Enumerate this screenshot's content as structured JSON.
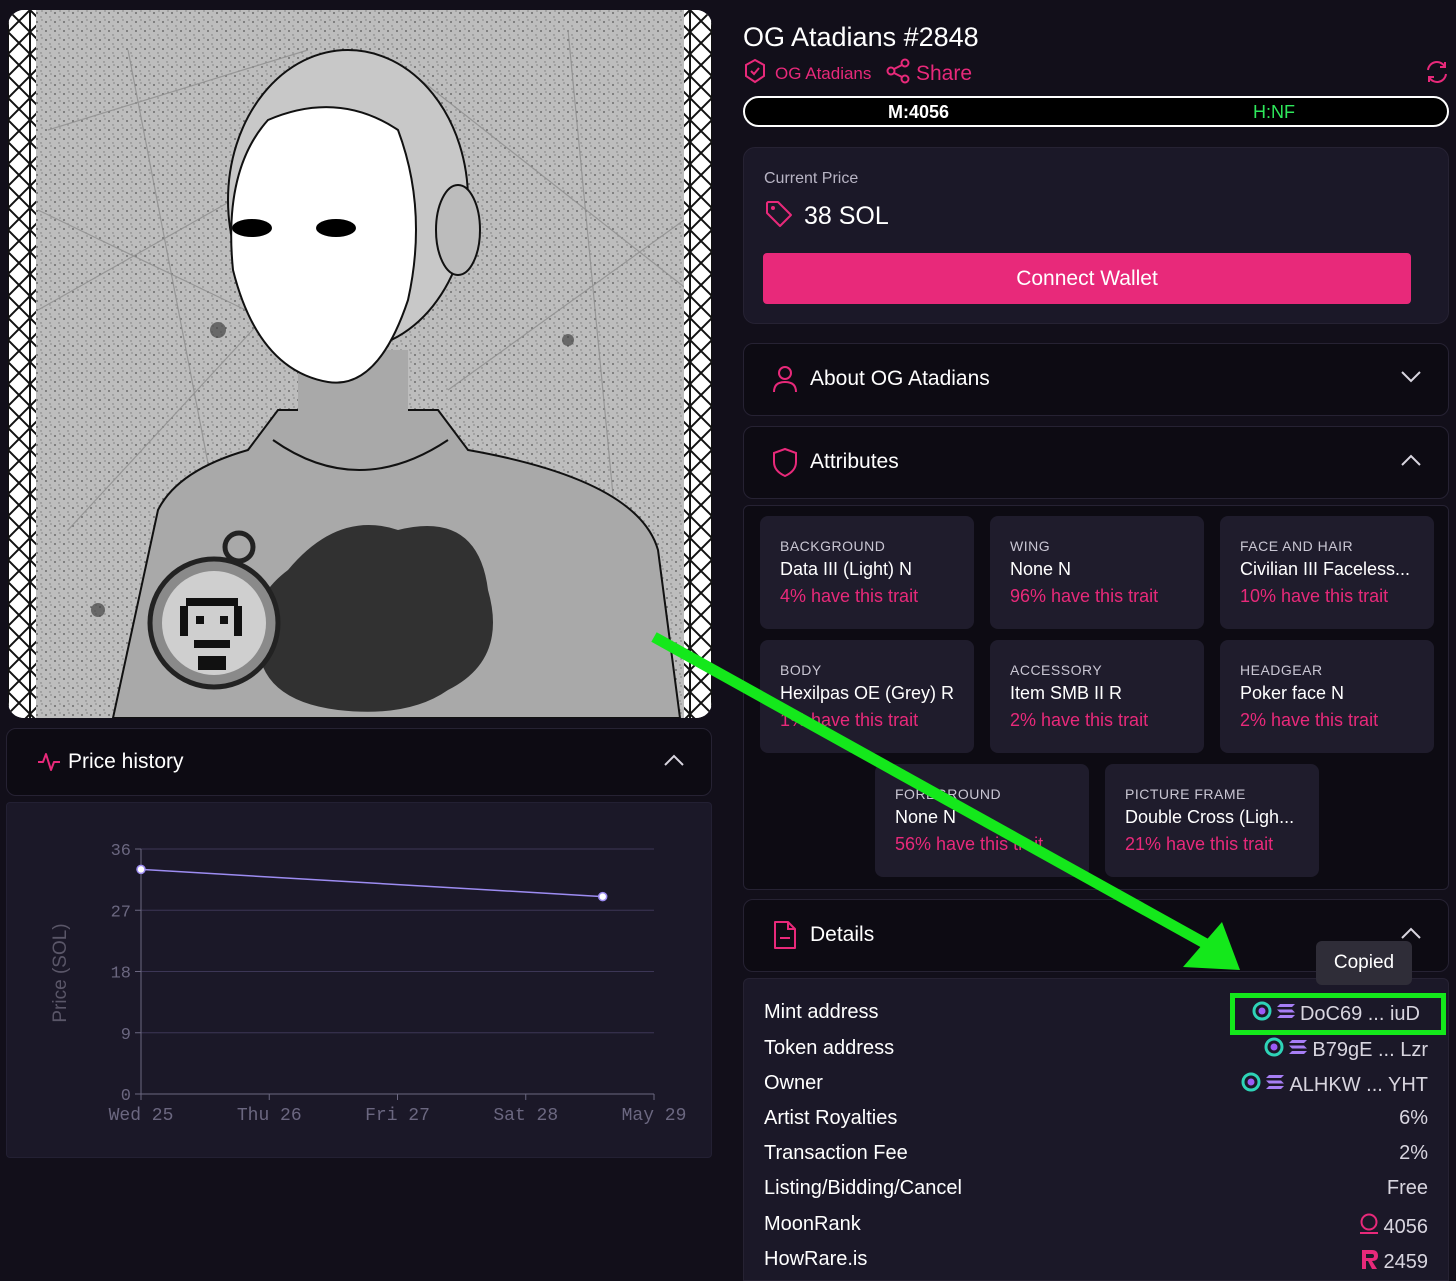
{
  "nft": {
    "title": "OG Atadians #2848",
    "collection": "OG Atadians",
    "share_label": "Share",
    "rank": {
      "m_label": "M:4056",
      "h_label": "H:NF"
    }
  },
  "price": {
    "label": "Current Price",
    "value": "38 SOL",
    "connect_label": "Connect Wallet"
  },
  "about": {
    "label": "About OG Atadians"
  },
  "attributes": {
    "label": "Attributes",
    "traits": [
      {
        "type": "BACKGROUND",
        "value": "Data III (Light) N",
        "pct": "4% have this trait"
      },
      {
        "type": "WING",
        "value": "None N",
        "pct": "96% have this trait"
      },
      {
        "type": "FACE AND HAIR",
        "value": "Civilian III Faceless...",
        "pct": "10% have this trait"
      },
      {
        "type": "BODY",
        "value": "Hexilpas OE (Grey) R",
        "pct": "1% have this trait"
      },
      {
        "type": "ACCESSORY",
        "value": "Item SMB II R",
        "pct": "2% have this trait"
      },
      {
        "type": "HEADGEAR",
        "value": "Poker face N",
        "pct": "2% have this trait"
      },
      {
        "type": "FOREGROUND",
        "value": "None N",
        "pct": "56% have this trait"
      },
      {
        "type": "PICTURE FRAME",
        "value": "Double Cross (Ligh...",
        "pct": "21% have this trait"
      }
    ]
  },
  "details": {
    "label": "Details",
    "tooltip": "Copied",
    "rows": [
      {
        "key": "Mint address",
        "value": "DoC69 ... iuD"
      },
      {
        "key": "Token address",
        "value": "B79gE ... Lzr"
      },
      {
        "key": "Owner",
        "value": "ALHKW ... YHT"
      },
      {
        "key": "Artist Royalties",
        "value": "6%"
      },
      {
        "key": "Transaction Fee",
        "value": "2%"
      },
      {
        "key": "Listing/Bidding/Cancel",
        "value": "Free"
      },
      {
        "key": "MoonRank",
        "value": "4056"
      },
      {
        "key": "HowRare.is",
        "value": "2459"
      }
    ]
  },
  "price_history": {
    "label": "Price history"
  },
  "colors": {
    "accent": "#e8297a",
    "green": "#2ee85b",
    "highlight": "#14e81b",
    "line": "#9d8cf2"
  },
  "chart_data": {
    "type": "line",
    "ylabel": "Price (SOL)",
    "xlabel": "",
    "x_ticks": [
      "Wed 25",
      "Thu 26",
      "Fri 27",
      "Sat 28",
      "May 29"
    ],
    "y_ticks": [
      0,
      9,
      18,
      27,
      36
    ],
    "ylim": [
      0,
      36
    ],
    "x_range": [
      25,
      29
    ],
    "series": [
      {
        "x": [
          25.0,
          28.6
        ],
        "y": [
          33,
          29
        ]
      }
    ],
    "grid": true
  }
}
